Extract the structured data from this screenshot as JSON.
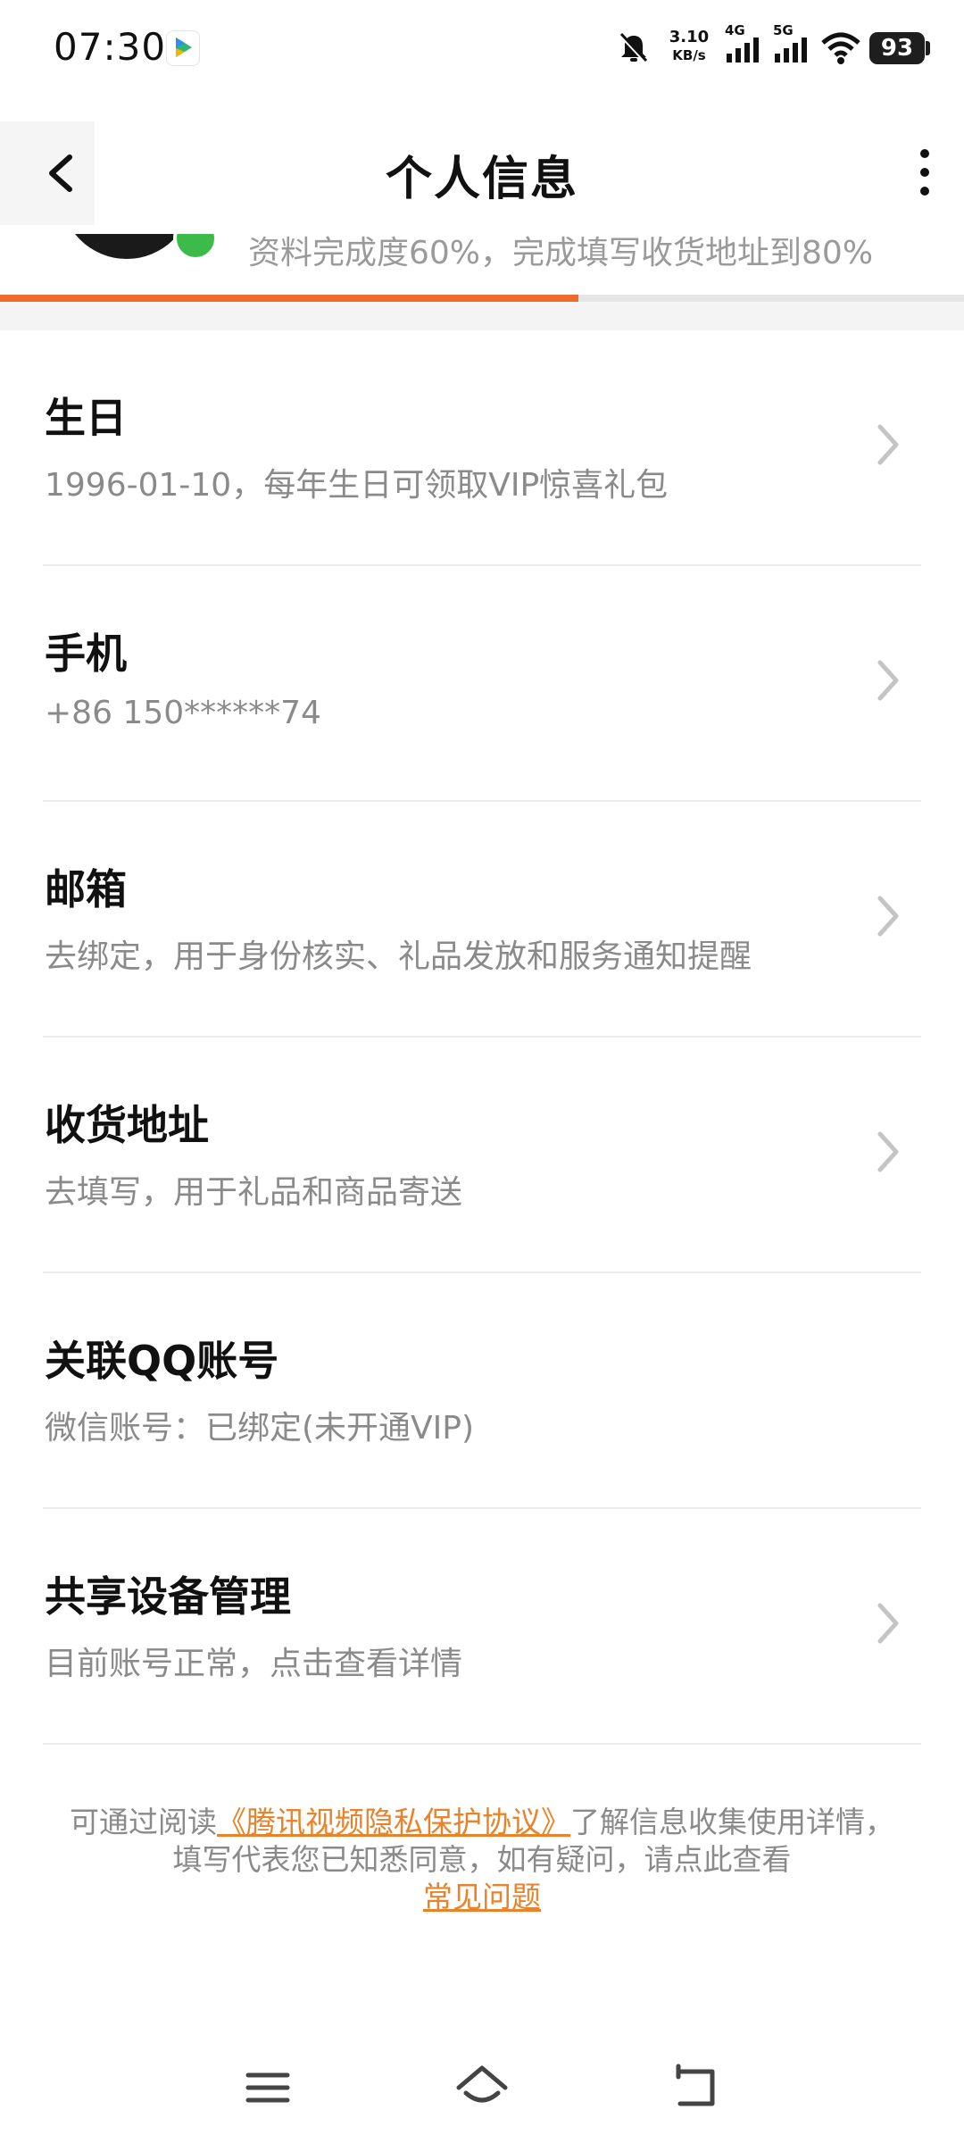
{
  "status_bar": {
    "time": "07:30",
    "net_speed_value": "3.10",
    "net_speed_unit": "KB/s",
    "signal_1": "4G",
    "signal_2": "5G",
    "battery": "93"
  },
  "header": {
    "title": "个人信息"
  },
  "profile": {
    "completion_text": "资料完成度60%，完成填写收货地址到80%",
    "completion_progress_percent": 60
  },
  "items": [
    {
      "title": "生日",
      "subtitle": "1996-01-10，每年生日可领取VIP惊喜礼包",
      "has_chevron": true
    },
    {
      "title": "手机",
      "subtitle": "+86 150******74",
      "has_chevron": true
    },
    {
      "title": "邮箱",
      "subtitle": "去绑定，用于身份核实、礼品发放和服务通知提醒",
      "has_chevron": true
    },
    {
      "title": "收货地址",
      "subtitle": "去填写，用于礼品和商品寄送",
      "has_chevron": true
    },
    {
      "title": "关联QQ账号",
      "subtitle": "微信账号：已绑定(未开通VIP)",
      "has_chevron": false
    },
    {
      "title": "共享设备管理",
      "subtitle": "目前账号正常，点击查看详情",
      "has_chevron": true
    }
  ],
  "footer": {
    "text_before": "可通过阅读",
    "privacy_link": "《腾讯视频隐私保护协议》",
    "text_middle": "了解信息收集使用详情，填写代表您已知悉同意，如有疑问，请点此查看",
    "faq_link": "常见问题"
  },
  "colors": {
    "accent": "#ef6a2e",
    "link": "#e8832b",
    "badge": "#3dbb4a"
  },
  "icons": {
    "back": "chevron-left-icon",
    "more": "more-vertical-icon",
    "row": "chevron-right-icon",
    "nav_menu": "menu-icon",
    "nav_home": "home-icon",
    "nav_back": "back-arrow-icon"
  }
}
